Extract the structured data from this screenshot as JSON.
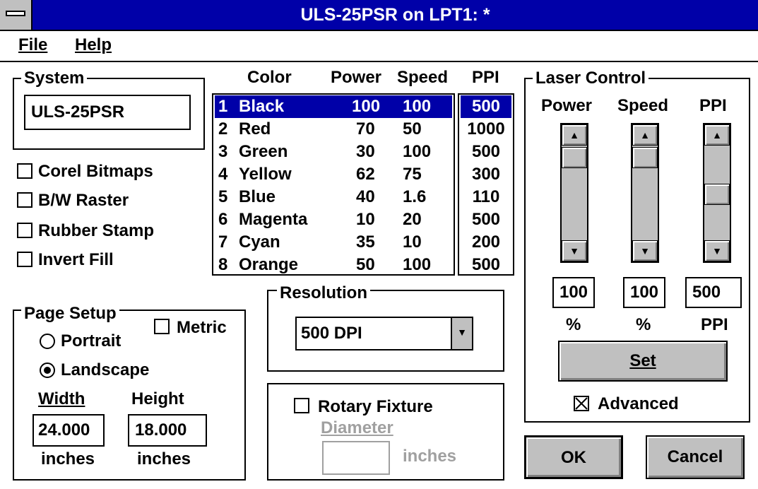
{
  "window": {
    "title": "ULS-25PSR on LPT1:  *"
  },
  "menu": {
    "file": "File",
    "help": "Help"
  },
  "system": {
    "label": "System",
    "value": "ULS-25PSR"
  },
  "options": [
    {
      "label": "Corel Bitmaps",
      "checked": false
    },
    {
      "label": "B/W Raster",
      "checked": false
    },
    {
      "label": "Rubber Stamp",
      "checked": false
    },
    {
      "label": "Invert Fill",
      "checked": false
    }
  ],
  "page_setup": {
    "label": "Page Setup",
    "portrait": "Portrait",
    "landscape": "Landscape",
    "selected": "Landscape",
    "metric": "Metric",
    "width_label": "Width",
    "height_label": "Height",
    "width": "24.000",
    "height": "18.000",
    "width_unit": "inches",
    "height_unit": "inches"
  },
  "color_table": {
    "headers": {
      "color": "Color",
      "power": "Power",
      "speed": "Speed",
      "ppi": "PPI"
    },
    "rows": [
      {
        "num": "1",
        "color": "Black",
        "power": "100",
        "speed": "100",
        "ppi": "500"
      },
      {
        "num": "2",
        "color": "Red",
        "power": "70",
        "speed": "50",
        "ppi": "1000"
      },
      {
        "num": "3",
        "color": "Green",
        "power": "30",
        "speed": "100",
        "ppi": "500"
      },
      {
        "num": "4",
        "color": "Yellow",
        "power": "62",
        "speed": "75",
        "ppi": "300"
      },
      {
        "num": "5",
        "color": "Blue",
        "power": "40",
        "speed": "1.6",
        "ppi": "110"
      },
      {
        "num": "6",
        "color": "Magenta",
        "power": "10",
        "speed": "20",
        "ppi": "500"
      },
      {
        "num": "7",
        "color": "Cyan",
        "power": "35",
        "speed": "10",
        "ppi": "200"
      },
      {
        "num": "8",
        "color": "Orange",
        "power": "50",
        "speed": "100",
        "ppi": "500"
      }
    ],
    "selected_index": 0
  },
  "resolution": {
    "label": "Resolution",
    "value": "500 DPI"
  },
  "rotary": {
    "label": "Rotary Fixture",
    "checked": false,
    "diameter_label": "Diameter",
    "unit": "inches"
  },
  "laser_control": {
    "label": "Laser Control",
    "power_label": "Power",
    "speed_label": "Speed",
    "ppi_label": "PPI",
    "power_value": "100",
    "speed_value": "100",
    "ppi_value": "500",
    "power_unit": "%",
    "speed_unit": "%",
    "ppi_unit": "PPI",
    "set_button": "Set",
    "advanced_label": "Advanced",
    "advanced_checked": true
  },
  "buttons": {
    "ok": "OK",
    "cancel": "Cancel"
  },
  "icons": {
    "system_menu": "system-menu-icon",
    "dropdown": "dropdown-arrow-icon",
    "scroll_up": "scroll-up-arrow-icon",
    "scroll_down": "scroll-down-arrow-icon"
  },
  "colors": {
    "titlebar": "#0000a8",
    "selection": "#0000a8",
    "face": "#c0c0c0",
    "disabled": "#a0a0a0"
  }
}
